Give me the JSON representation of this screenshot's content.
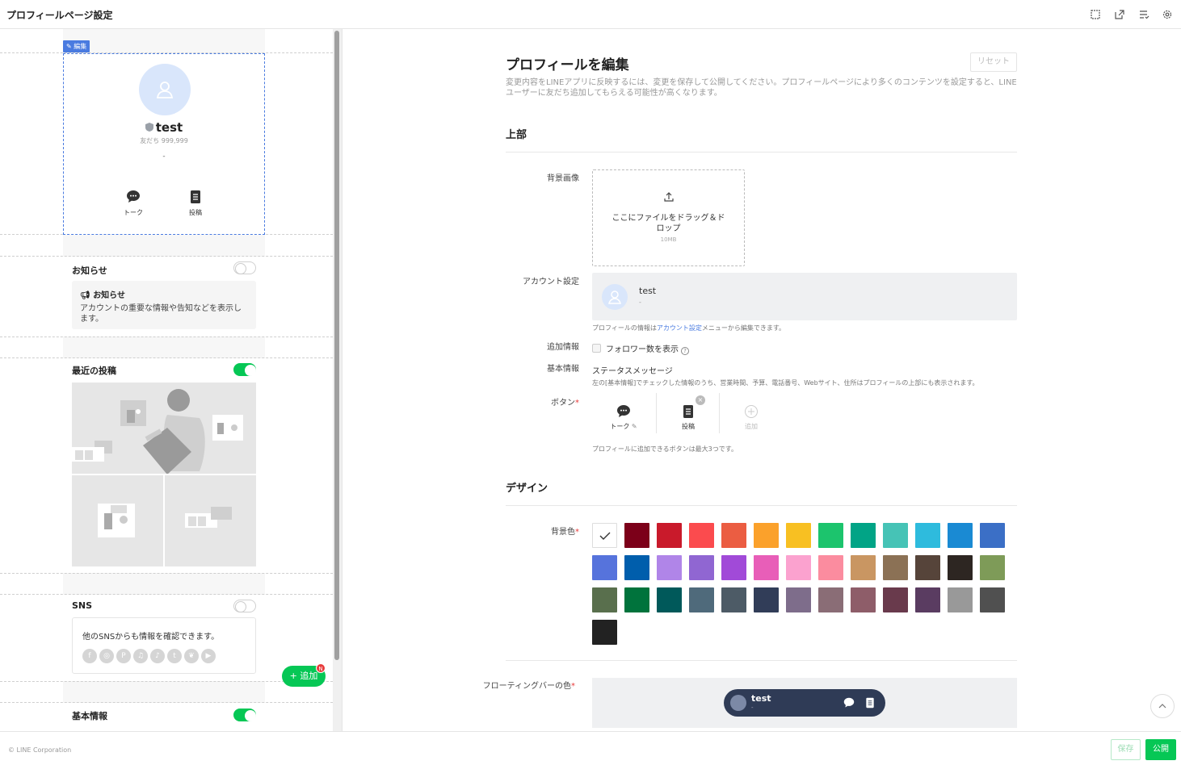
{
  "header": {
    "title": "プロフィールページ設定",
    "icons": [
      "layout-icon",
      "external-link-icon",
      "checklist-icon",
      "gear-icon"
    ]
  },
  "preview": {
    "edit_tag": "編集",
    "profile": {
      "name": "test",
      "friends": "友だち 999,999",
      "status": "-"
    },
    "buttons": [
      {
        "label": "トーク",
        "icon": "chat-icon"
      },
      {
        "label": "投稿",
        "icon": "post-icon"
      }
    ],
    "sections": {
      "notice": {
        "title": "お知らせ",
        "enabled": false,
        "box_title": "お知らせ",
        "box_desc": "アカウントの重要な情報や告知などを表示します。"
      },
      "posts": {
        "title": "最近の投稿",
        "enabled": true
      },
      "sns": {
        "title": "SNS",
        "enabled": false,
        "desc": "他のSNSからも情報を確認できます。",
        "icons": [
          "f",
          "◎",
          "P",
          "♫",
          "♪",
          "t",
          "❦",
          "▶"
        ]
      },
      "basic": {
        "title": "基本情報",
        "enabled": true
      }
    },
    "add_button": "+ 追加",
    "add_badge": "N"
  },
  "editor": {
    "title": "プロフィールを編集",
    "reset": "リセット",
    "desc": "変更内容をLINEアプリに反映するには、変更を保存して公開してください。プロフィールページにより多くのコンテンツを設定すると、LINEユーザーに友だち追加してもらえる可能性が高くなります。",
    "top_section": "上部",
    "bg_image": {
      "label": "背景画像",
      "drop_text": "ここにファイルをドラッグ＆ドロップ",
      "size": "10MB"
    },
    "account": {
      "label": "アカウント設定",
      "name": "test",
      "status": "-",
      "note_pre": "プロフィールの情報は",
      "note_link": "アカウント設定",
      "note_post": "メニューから編集できます。"
    },
    "extra": {
      "label": "追加情報",
      "checkbox": "フォロワー数を表示",
      "checked": false
    },
    "basic": {
      "label": "基本情報",
      "value": "ステータスメッセージ",
      "note": "左の[基本情報]でチェックした情報のうち、営業時間、予算、電話番号、Webサイト、住所はプロフィールの上部にも表示されます。"
    },
    "buttons": {
      "label": "ボタン",
      "slots": [
        {
          "label": "トーク"
        },
        {
          "label": "投稿"
        },
        {
          "label": "追加"
        }
      ],
      "note": "プロフィールに追加できるボタンは最大3つです。"
    },
    "design_section": "デザイン",
    "bg_color": {
      "label": "背景色",
      "selected": 0,
      "colors": [
        "#ffffff",
        "#7c0019",
        "#c91a2b",
        "#fb4b4e",
        "#eb5d42",
        "#fba12b",
        "#f8c022",
        "#1cc46d",
        "#01a486",
        "#46c3b6",
        "#2ebbdd",
        "#1a8ad3",
        "#3b6fc6",
        "#5673dc",
        "#005eac",
        "#b085e8",
        "#9066d2",
        "#a14ad8",
        "#e85eb8",
        "#fba2cf",
        "#fb8c9f",
        "#c99662",
        "#8b7155",
        "#56443a",
        "#2d2622",
        "#7e9b58",
        "#596f4d",
        "#00733c",
        "#00595a",
        "#4f6a7b",
        "#4d5b66",
        "#313d58",
        "#7e6d8b",
        "#8a6d76",
        "#8e5d69",
        "#693a4c",
        "#5a3c61",
        "#999999",
        "#505050",
        "#222222"
      ]
    },
    "float_bar": {
      "label": "フローティングバーの色",
      "name": "test",
      "status": "-"
    }
  },
  "footer": {
    "copyright": "© LINE Corporation",
    "save": "保存",
    "publish": "公開"
  }
}
